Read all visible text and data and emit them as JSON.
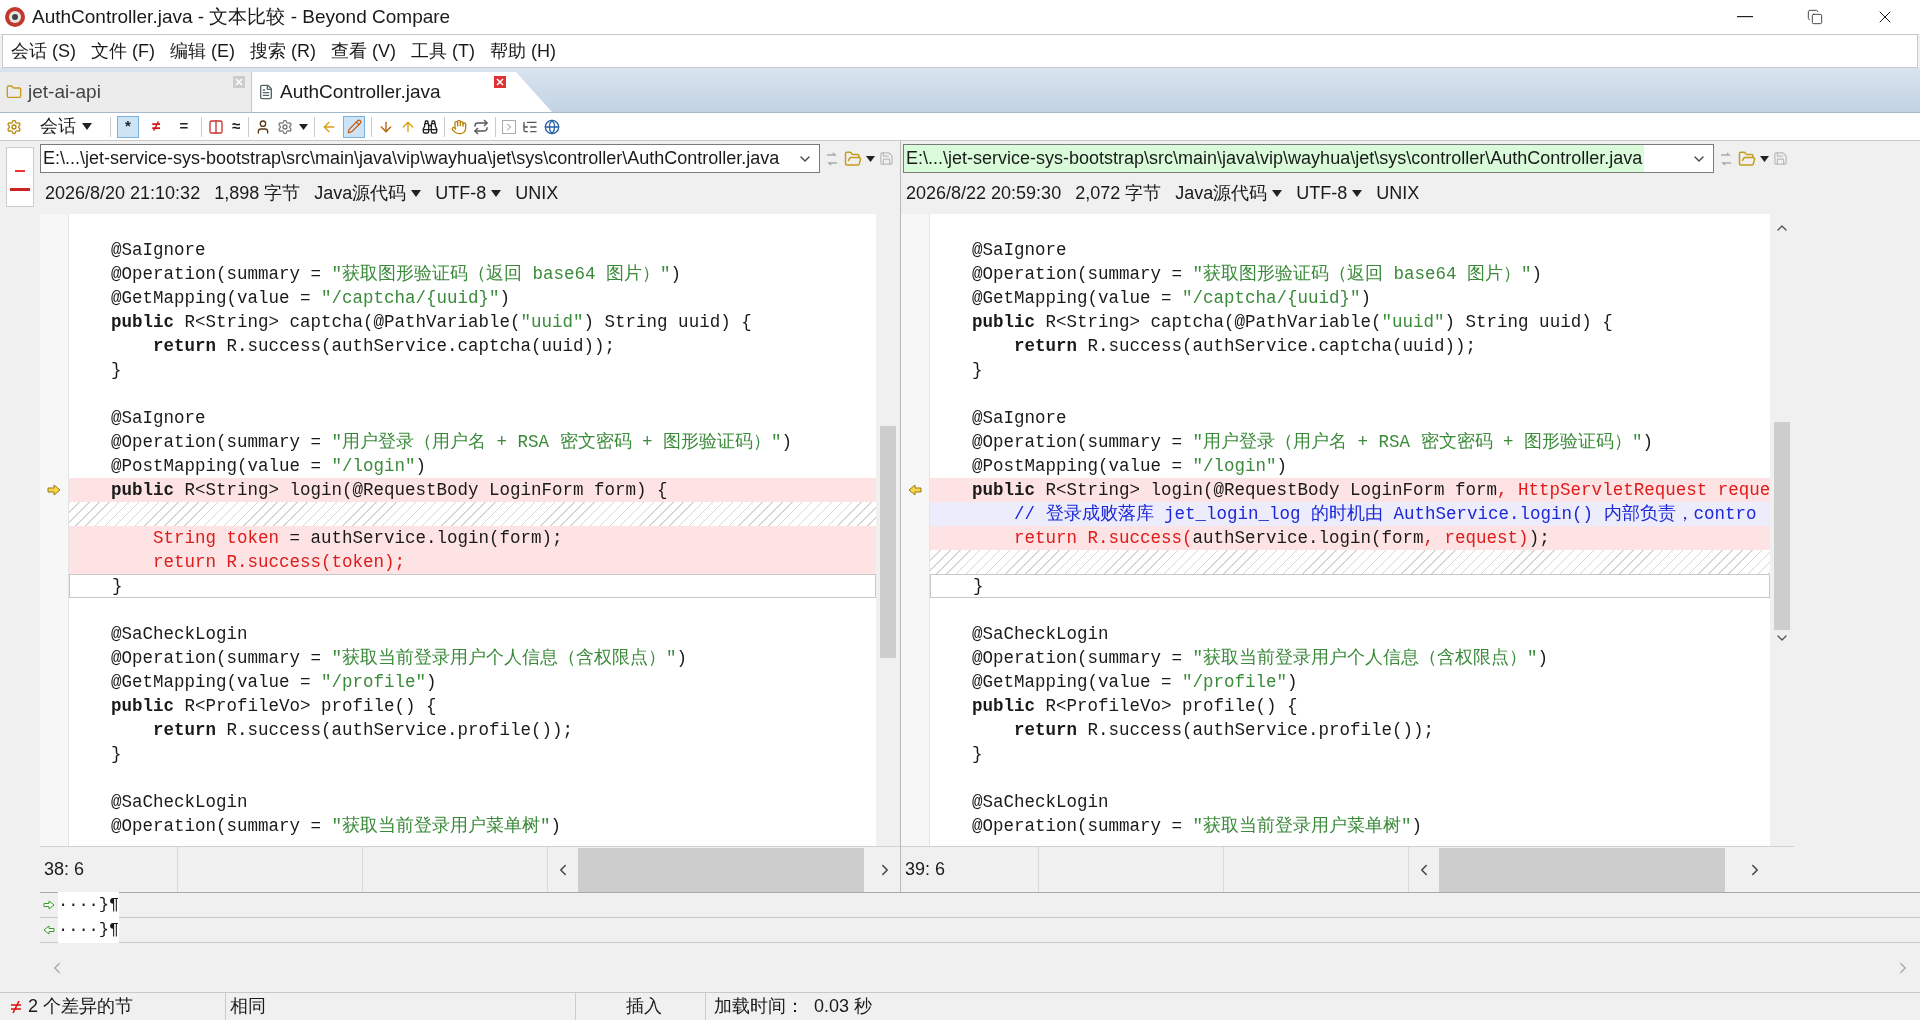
{
  "window": {
    "title": "AuthController.java - 文本比较 - Beyond Compare"
  },
  "menu": [
    "会话 (S)",
    "文件 (F)",
    "编辑 (E)",
    "搜索 (R)",
    "查看 (V)",
    "工具 (T)",
    "帮助 (H)"
  ],
  "tabs": [
    {
      "label": "jet-ai-api",
      "selected": false
    },
    {
      "label": "AuthController.java",
      "selected": true
    }
  ],
  "toolbar": {
    "session": "会话",
    "filters": [
      {
        "label": "*",
        "selected": true
      },
      {
        "label": "≠",
        "selected": false
      },
      {
        "label": "=",
        "selected": false
      }
    ],
    "approx": "≈",
    "edit_selected": true
  },
  "panes": [
    {
      "path": "E:\\...\\jet-service-sys-bootstrap\\src\\main\\java\\vip\\wayhua\\jet\\sys\\controller\\AuthController.java",
      "highlighted": false,
      "date": "2026/8/20 21:10:32",
      "size": "1,898 字节",
      "format": "Java源代码",
      "encoding": "UTF-8",
      "line_ending": "UNIX",
      "cursor": "38: 6",
      "lines": [
        {
          "kind": "same"
        },
        {
          "kind": "same",
          "segments": [
            {
              "text": "    @SaIgnore",
              "kind": "plain"
            }
          ]
        },
        {
          "kind": "same",
          "segments": [
            {
              "text": "    @Operation(summary = ",
              "kind": "plain"
            },
            {
              "text": "\"获取图形验证码（返回 base64 图片）\"",
              "kind": "string"
            },
            {
              "text": ")",
              "kind": "plain"
            }
          ]
        },
        {
          "kind": "same",
          "segments": [
            {
              "text": "    @GetMapping(value = ",
              "kind": "plain"
            },
            {
              "text": "\"/captcha/{uuid}\"",
              "kind": "string"
            },
            {
              "text": ")",
              "kind": "plain"
            }
          ]
        },
        {
          "kind": "same",
          "segments": [
            {
              "text": "    public",
              "kind": "keyword"
            },
            {
              "text": " R<String> captcha(@PathVariable(",
              "kind": "plain"
            },
            {
              "text": "\"uuid\"",
              "kind": "string"
            },
            {
              "text": ") String uuid) {",
              "kind": "plain"
            }
          ]
        },
        {
          "kind": "same",
          "segments": [
            {
              "text": "        return",
              "kind": "keyword"
            },
            {
              "text": " R.success(authService.captcha(uuid));",
              "kind": "plain"
            }
          ]
        },
        {
          "kind": "same",
          "segments": [
            {
              "text": "    }",
              "kind": "plain"
            }
          ]
        },
        {
          "kind": "same"
        },
        {
          "kind": "same",
          "segments": [
            {
              "text": "    @SaIgnore",
              "kind": "plain"
            }
          ]
        },
        {
          "kind": "same",
          "segments": [
            {
              "text": "    @Operation(summary = ",
              "kind": "plain"
            },
            {
              "text": "\"用户登录（用户名 + RSA 密文密码 + 图形验证码）\"",
              "kind": "string"
            },
            {
              "text": ")",
              "kind": "plain"
            }
          ]
        },
        {
          "kind": "same",
          "segments": [
            {
              "text": "    @PostMapping(value = ",
              "kind": "plain"
            },
            {
              "text": "\"/login\"",
              "kind": "string"
            },
            {
              "text": ")",
              "kind": "plain"
            }
          ]
        },
        {
          "kind": "diff_start",
          "segments": [
            {
              "text": "    public",
              "kind": "keyword"
            },
            {
              "text": " R<String> login(@RequestBody LoginForm form) {",
              "kind": "plain"
            }
          ]
        },
        {
          "kind": "gap"
        },
        {
          "kind": "diff",
          "segments": [
            {
              "text": "        String token",
              "kind": "changed"
            },
            {
              "text": " = authService.login(form);",
              "kind": "plain"
            }
          ]
        },
        {
          "kind": "diff",
          "segments": [
            {
              "text": "        return R.success(token);",
              "kind": "changed"
            }
          ]
        },
        {
          "kind": "current",
          "segments": [
            {
              "text": "    }",
              "kind": "plain"
            }
          ]
        },
        {
          "kind": "same"
        },
        {
          "kind": "same",
          "segments": [
            {
              "text": "    @SaCheckLogin",
              "kind": "plain"
            }
          ]
        },
        {
          "kind": "same",
          "segments": [
            {
              "text": "    @Operation(summary = ",
              "kind": "plain"
            },
            {
              "text": "\"获取当前登录用户个人信息（含权限点）\"",
              "kind": "string"
            },
            {
              "text": ")",
              "kind": "plain"
            }
          ]
        },
        {
          "kind": "same",
          "segments": [
            {
              "text": "    @GetMapping(value = ",
              "kind": "plain"
            },
            {
              "text": "\"/profile\"",
              "kind": "string"
            },
            {
              "text": ")",
              "kind": "plain"
            }
          ]
        },
        {
          "kind": "same",
          "segments": [
            {
              "text": "    public",
              "kind": "keyword"
            },
            {
              "text": " R<ProfileVo> profile() {",
              "kind": "plain"
            }
          ]
        },
        {
          "kind": "same",
          "segments": [
            {
              "text": "        return",
              "kind": "keyword"
            },
            {
              "text": " R.success(authService.profile());",
              "kind": "plain"
            }
          ]
        },
        {
          "kind": "same",
          "segments": [
            {
              "text": "    }",
              "kind": "plain"
            }
          ]
        },
        {
          "kind": "same"
        },
        {
          "kind": "same",
          "segments": [
            {
              "text": "    @SaCheckLogin",
              "kind": "plain"
            }
          ]
        },
        {
          "kind": "same",
          "segments": [
            {
              "text": "    @Operation(summary = ",
              "kind": "plain"
            },
            {
              "text": "\"获取当前登录用户菜单树\"",
              "kind": "string"
            },
            {
              "text": ")",
              "kind": "plain"
            }
          ]
        }
      ]
    },
    {
      "path": "E:\\...\\jet-service-sys-bootstrap\\src\\main\\java\\vip\\wayhua\\jet\\sys\\controller\\AuthController.java",
      "highlighted": true,
      "date": "2026/8/22 20:59:30",
      "size": "2,072 字节",
      "format": "Java源代码",
      "encoding": "UTF-8",
      "line_ending": "UNIX",
      "cursor": "39: 6",
      "lines": [
        {
          "kind": "same"
        },
        {
          "kind": "same",
          "segments": [
            {
              "text": "    @SaIgnore",
              "kind": "plain"
            }
          ]
        },
        {
          "kind": "same",
          "segments": [
            {
              "text": "    @Operation(summary = ",
              "kind": "plain"
            },
            {
              "text": "\"获取图形验证码（返回 base64 图片）\"",
              "kind": "string"
            },
            {
              "text": ")",
              "kind": "plain"
            }
          ]
        },
        {
          "kind": "same",
          "segments": [
            {
              "text": "    @GetMapping(value = ",
              "kind": "plain"
            },
            {
              "text": "\"/captcha/{uuid}\"",
              "kind": "string"
            },
            {
              "text": ")",
              "kind": "plain"
            }
          ]
        },
        {
          "kind": "same",
          "segments": [
            {
              "text": "    public",
              "kind": "keyword"
            },
            {
              "text": " R<String> captcha(@PathVariable(",
              "kind": "plain"
            },
            {
              "text": "\"uuid\"",
              "kind": "string"
            },
            {
              "text": ") String uuid) {",
              "kind": "plain"
            }
          ]
        },
        {
          "kind": "same",
          "segments": [
            {
              "text": "        return",
              "kind": "keyword"
            },
            {
              "text": " R.success(authService.captcha(uuid));",
              "kind": "plain"
            }
          ]
        },
        {
          "kind": "same",
          "segments": [
            {
              "text": "    }",
              "kind": "plain"
            }
          ]
        },
        {
          "kind": "same"
        },
        {
          "kind": "same",
          "segments": [
            {
              "text": "    @SaIgnore",
              "kind": "plain"
            }
          ]
        },
        {
          "kind": "same",
          "segments": [
            {
              "text": "    @Operation(summary = ",
              "kind": "plain"
            },
            {
              "text": "\"用户登录（用户名 + RSA 密文密码 + 图形验证码）\"",
              "kind": "string"
            },
            {
              "text": ")",
              "kind": "plain"
            }
          ]
        },
        {
          "kind": "same",
          "segments": [
            {
              "text": "    @PostMapping(value = ",
              "kind": "plain"
            },
            {
              "text": "\"/login\"",
              "kind": "string"
            },
            {
              "text": ")",
              "kind": "plain"
            }
          ]
        },
        {
          "kind": "diff_start",
          "segments": [
            {
              "text": "    public",
              "kind": "keyword"
            },
            {
              "text": " R<String> login(@RequestBody LoginForm form",
              "kind": "plain"
            },
            {
              "text": ", HttpServletRequest reque",
              "kind": "changed"
            }
          ]
        },
        {
          "kind": "minor",
          "segments": [
            {
              "text": "        // 登录成败落库 jet_login_log 的时机由 AuthService.login() 内部负责，contro",
              "kind": "comment"
            }
          ]
        },
        {
          "kind": "diff",
          "segments": [
            {
              "text": "        return R.success(",
              "kind": "changed"
            },
            {
              "text": "authService.login(form",
              "kind": "plain"
            },
            {
              "text": ", request)",
              "kind": "changed"
            },
            {
              "text": ");",
              "kind": "plain"
            }
          ]
        },
        {
          "kind": "gap"
        },
        {
          "kind": "current",
          "segments": [
            {
              "text": "    }",
              "kind": "plain"
            }
          ]
        },
        {
          "kind": "same"
        },
        {
          "kind": "same",
          "segments": [
            {
              "text": "    @SaCheckLogin",
              "kind": "plain"
            }
          ]
        },
        {
          "kind": "same",
          "segments": [
            {
              "text": "    @Operation(summary = ",
              "kind": "plain"
            },
            {
              "text": "\"获取当前登录用户个人信息（含权限点）\"",
              "kind": "string"
            },
            {
              "text": ")",
              "kind": "plain"
            }
          ]
        },
        {
          "kind": "same",
          "segments": [
            {
              "text": "    @GetMapping(value = ",
              "kind": "plain"
            },
            {
              "text": "\"/profile\"",
              "kind": "string"
            },
            {
              "text": ")",
              "kind": "plain"
            }
          ]
        },
        {
          "kind": "same",
          "segments": [
            {
              "text": "    public",
              "kind": "keyword"
            },
            {
              "text": " R<ProfileVo> profile() {",
              "kind": "plain"
            }
          ]
        },
        {
          "kind": "same",
          "segments": [
            {
              "text": "        return",
              "kind": "keyword"
            },
            {
              "text": " R.success(authService.profile());",
              "kind": "plain"
            }
          ]
        },
        {
          "kind": "same",
          "segments": [
            {
              "text": "    }",
              "kind": "plain"
            }
          ]
        },
        {
          "kind": "same"
        },
        {
          "kind": "same",
          "segments": [
            {
              "text": "    @SaCheckLogin",
              "kind": "plain"
            }
          ]
        },
        {
          "kind": "same",
          "segments": [
            {
              "text": "    @Operation(summary = ",
              "kind": "plain"
            },
            {
              "text": "\"获取当前登录用户菜单树\"",
              "kind": "string"
            },
            {
              "text": ")",
              "kind": "plain"
            }
          ]
        }
      ]
    }
  ],
  "detail": [
    {
      "kind": "left_file",
      "text": "····}¶"
    },
    {
      "kind": "right_file",
      "text": "····}¶"
    }
  ],
  "status_bar": {
    "differences": "2 个差异的节",
    "state": "相同",
    "mode": "插入",
    "load_time": "加载时间：  0.03 秒"
  }
}
